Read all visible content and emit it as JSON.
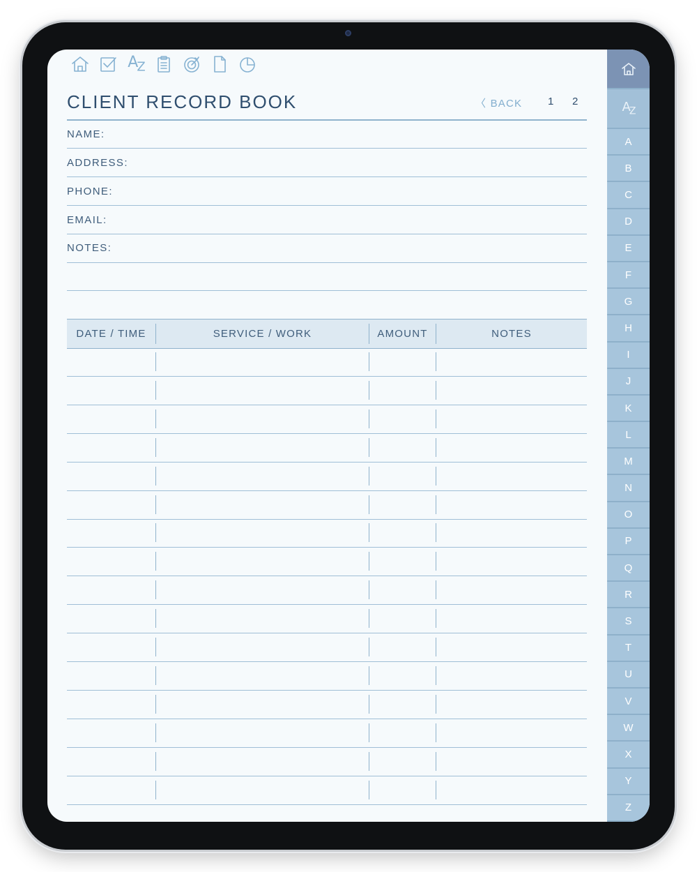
{
  "toolbar": {
    "icons": [
      "home-icon",
      "checkbox-icon",
      "az-index-icon",
      "clipboard-icon",
      "target-icon",
      "document-icon",
      "pie-chart-icon"
    ],
    "az_label": "AZ"
  },
  "header": {
    "title": "CLIENT RECORD BOOK",
    "back_label": "〈  BACK",
    "pages": [
      "1",
      "2"
    ]
  },
  "fields": [
    "NAME:",
    "ADDRESS:",
    "PHONE:",
    "EMAIL:",
    "NOTES:"
  ],
  "table": {
    "columns": [
      "DATE / TIME",
      "SERVICE / WORK",
      "AMOUNT",
      "NOTES"
    ],
    "row_count": 16
  },
  "sidebar": {
    "az_label": "AZ",
    "letters": [
      "A",
      "B",
      "C",
      "D",
      "E",
      "F",
      "G",
      "H",
      "I",
      "J",
      "K",
      "L",
      "M",
      "N",
      "O",
      "P",
      "Q",
      "R",
      "S",
      "T",
      "U",
      "V",
      "W",
      "X",
      "Y",
      "Z"
    ]
  },
  "colors": {
    "accent": "#86b2d2",
    "title": "#2f4e6e",
    "tab": "#a7c5dc",
    "tab_home": "#7c93b4",
    "header_fill": "#dde9f2"
  }
}
